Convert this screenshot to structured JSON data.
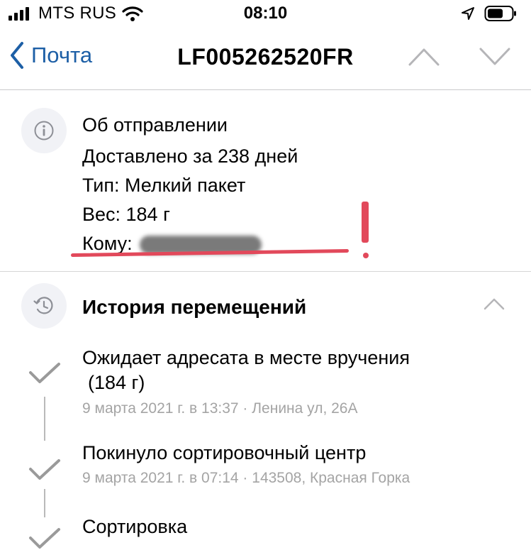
{
  "status_bar": {
    "carrier": "MTS RUS",
    "time": "08:10"
  },
  "nav": {
    "back_label": "Почта",
    "title": "LF005262520FR"
  },
  "shipment_info": {
    "heading": "Об отправлении",
    "delivered": "Доставлено за 238 дней",
    "type": "Тип: Мелкий пакет",
    "weight": "Вес: 184 г",
    "recipient_label": "Кому:"
  },
  "history": {
    "title": "История перемещений",
    "events": [
      {
        "title_line1": "Ожидает адресата в месте вручения",
        "title_line2": "(184 г)",
        "meta": "9 марта 2021 г. в 13:37 · Ленина ул, 26А"
      },
      {
        "title_line1": "Покинуло сортировочный центр",
        "meta": "9 марта 2021 г. в 07:14 · 143508, Красная Горка"
      },
      {
        "title_line1": "Сортировка"
      }
    ]
  },
  "colors": {
    "accent": "#1d5fa6",
    "annotation": "#e2495b",
    "meta_text": "#a4a4a4"
  }
}
